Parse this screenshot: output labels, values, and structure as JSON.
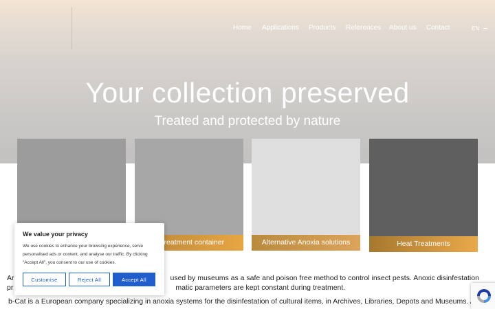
{
  "nav": {
    "items": [
      "Home",
      "Applications",
      "Products",
      "References",
      "About us",
      "Contact"
    ],
    "lang": "EN"
  },
  "hero": {
    "title": "Your collection preserved",
    "subtitle": "Treated and protected by nature"
  },
  "cards": [
    {
      "label": ""
    },
    {
      "label": "a Treatment container"
    },
    {
      "label": "Alternative Anoxia solutions"
    },
    {
      "label": "Heat Treatments"
    }
  ],
  "body": {
    "p1_start": "Ar",
    "p1_end": "used by museums as a safe and poison free method to control insect pests. Anoxic disinfestation",
    "p2_start": "pr",
    "p2_end": "matic parameters are kept constant during treatment.",
    "p3": "b-Cat is a European company specializing in anoxia systems for the disinfestation of cultural items, in Archives, Libraries, Depots and Museums. A wide r"
  },
  "cookie": {
    "title": "We value your privacy",
    "text": "We use cookies to enhance your browsing experience, serve personalised ads or content, and analyse our traffic. By clicking \"Accept All\", you consent to our use of cookies.",
    "customise": "Customise",
    "reject": "Reject All",
    "accept": "Accept All"
  },
  "colors": {
    "accent": "#e8a642",
    "cookie_button": "#1f5ccc"
  }
}
